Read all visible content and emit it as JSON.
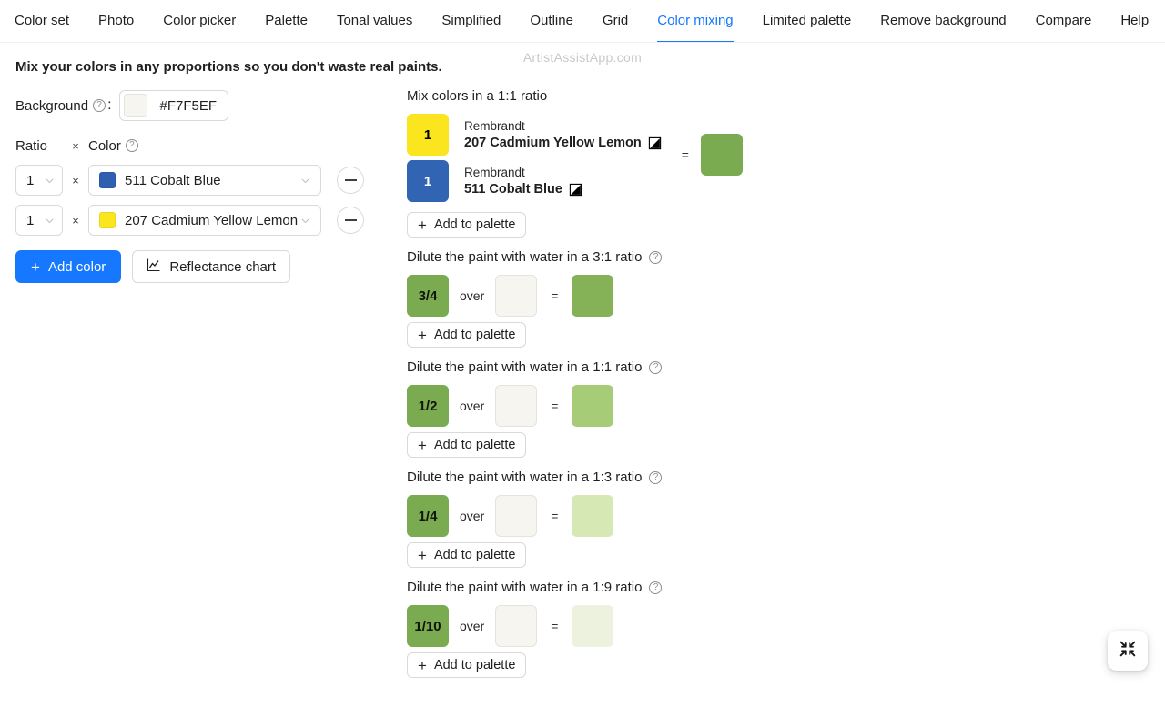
{
  "tabs": [
    {
      "label": "Color set",
      "active": false
    },
    {
      "label": "Photo",
      "active": false
    },
    {
      "label": "Color picker",
      "active": false
    },
    {
      "label": "Palette",
      "active": false
    },
    {
      "label": "Tonal values",
      "active": false
    },
    {
      "label": "Simplified",
      "active": false
    },
    {
      "label": "Outline",
      "active": false
    },
    {
      "label": "Grid",
      "active": false
    },
    {
      "label": "Color mixing",
      "active": true
    },
    {
      "label": "Limited palette",
      "active": false
    },
    {
      "label": "Remove background",
      "active": false
    },
    {
      "label": "Compare",
      "active": false
    },
    {
      "label": "Help",
      "active": false
    }
  ],
  "watermark": "ArtistAssistApp.com",
  "intro": "Mix your colors in any proportions so you don't waste real paints.",
  "controls": {
    "background_label": "Background",
    "background_colon": ":",
    "background_hex": "#F7F5EF",
    "background_swatch": "#F7F5EF",
    "help_glyph": "?",
    "ratio_header": "Ratio",
    "times_header": "×",
    "color_header": "Color",
    "rows": [
      {
        "ratio": "1",
        "times": "×",
        "color_name": "511 Cobalt Blue",
        "swatch": "#2E5FB0",
        "remove_label": "—"
      },
      {
        "ratio": "1",
        "times": "×",
        "color_name": "207 Cadmium Yellow Lemon",
        "swatch": "#FAE51E",
        "remove_label": "—"
      }
    ],
    "add_color_label": "Add color",
    "add_color_icon": "plus-icon",
    "reflectance_label": "Reflectance chart",
    "reflectance_icon": "line-chart-icon"
  },
  "mix": {
    "title": "Mix colors in a 1:1 ratio",
    "components": [
      {
        "part": "1",
        "brand": "Rembrandt",
        "name": "207 Cadmium Yellow Lemon",
        "swatch": "#FAE51E",
        "text_color": "#000000",
        "opacity_icon": "semi-opaque-icon"
      },
      {
        "part": "1",
        "brand": "Rembrandt",
        "name": "511 Cobalt Blue",
        "swatch": "#3264B4",
        "text_color": "#FFFFFF",
        "opacity_icon": "semi-opaque-icon"
      }
    ],
    "equals": "=",
    "result_swatch": "#7BAB51",
    "add_to_palette": "Add to palette"
  },
  "dilutions": [
    {
      "title": "Dilute the paint with water in a 3:1 ratio",
      "fraction": "3/4",
      "fraction_swatch": "#7BAB51",
      "over": "over",
      "background_swatch": "#F7F5EF",
      "equals": "=",
      "result_swatch": "#85B257",
      "add_to_palette": "Add to palette"
    },
    {
      "title": "Dilute the paint with water in a 1:1 ratio",
      "fraction": "1/2",
      "fraction_swatch": "#7BAB51",
      "over": "over",
      "background_swatch": "#F7F5EF",
      "equals": "=",
      "result_swatch": "#A6CC77",
      "add_to_palette": "Add to palette"
    },
    {
      "title": "Dilute the paint with water in a 1:3 ratio",
      "fraction": "1/4",
      "fraction_swatch": "#7BAB51",
      "over": "over",
      "background_swatch": "#F7F5EF",
      "equals": "=",
      "result_swatch": "#D6E9B4",
      "add_to_palette": "Add to palette"
    },
    {
      "title": "Dilute the paint with water in a 1:9 ratio",
      "fraction": "1/10",
      "fraction_swatch": "#7BAB51",
      "over": "over",
      "background_swatch": "#F7F5EF",
      "equals": "=",
      "result_swatch": "#EDF2DE",
      "add_to_palette": "Add to palette"
    }
  ],
  "fab": {
    "icon": "compress-icon"
  },
  "colors": {
    "accent": "#1677ff",
    "border": "#d9d9d9",
    "text": "rgba(0,0,0,0.88)"
  }
}
